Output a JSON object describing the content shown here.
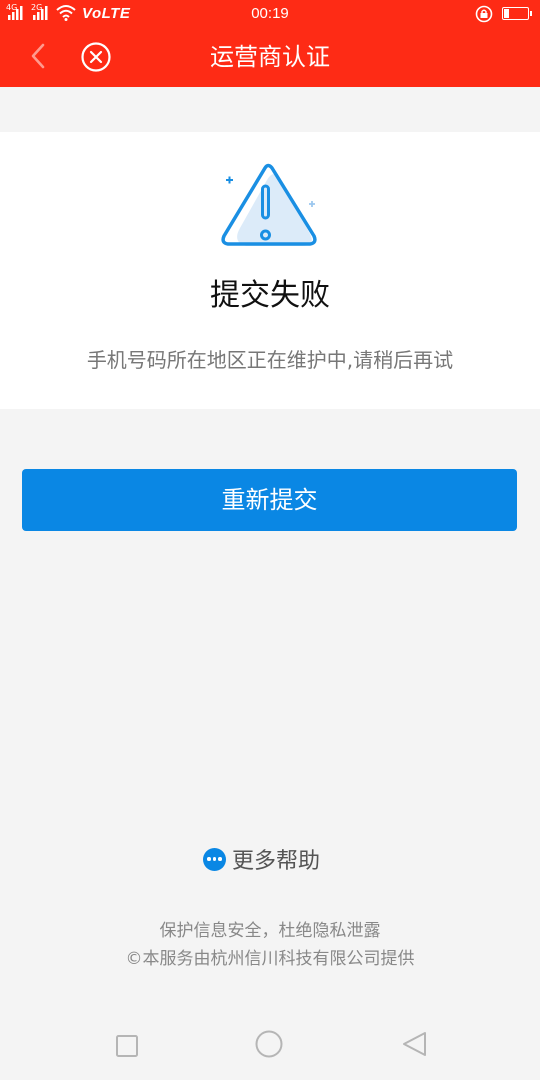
{
  "status_bar": {
    "signal_1_label": "4G",
    "signal_2_label": "2G",
    "network": "VoLTE",
    "time": "00:19",
    "battery_level": 0.2
  },
  "header": {
    "title": "运营商认证",
    "background_color": "#fe2b15"
  },
  "result": {
    "title": "提交失败",
    "message": "手机号码所在地区正在维护中,请稍后再试"
  },
  "actions": {
    "resubmit_label": "重新提交",
    "accent_color": "#0a87e4"
  },
  "help": {
    "label": "更多帮助"
  },
  "footer": {
    "line1": "保护信息安全，杜绝隐私泄露",
    "line2": "©本服务由杭州信川科技有限公司提供"
  }
}
